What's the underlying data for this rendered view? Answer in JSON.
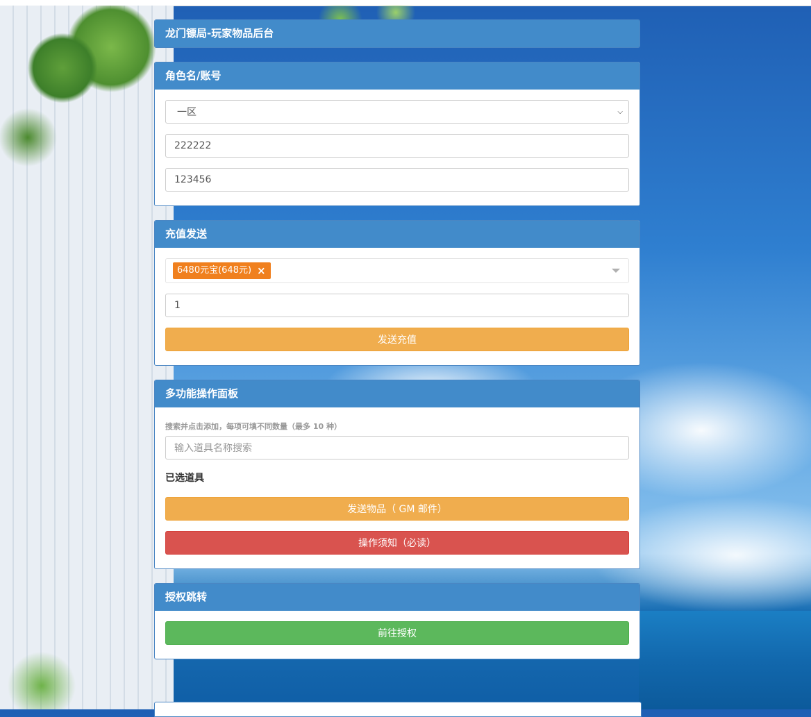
{
  "page": {
    "title": "龙门镖局-玩家物品后台"
  },
  "account": {
    "heading": "角色名/账号",
    "server_selected": "一区",
    "role_name_value": "222222",
    "password_value": "123456"
  },
  "recharge": {
    "heading": "充值发送",
    "selected_tag": "6480元宝(648元)",
    "tag_remove": "×",
    "quantity_value": "1",
    "send_label": "发送充值"
  },
  "multi": {
    "heading": "多功能操作面板",
    "hint": "搜索并点击添加，每项可填不同数量（最多 10 种）",
    "search_placeholder": "输入道具名称搜索",
    "selected_heading": "已选道具",
    "send_items_label": "发送物品（ GM 邮件）",
    "notice_label": "操作须知（必读）"
  },
  "auth": {
    "heading": "授权跳转",
    "goto_label": "前往授权"
  },
  "colors": {
    "panel_header": "#428bca",
    "warning": "#f0ad4e",
    "danger": "#d9534f",
    "success": "#5cb85c",
    "tag": "#f0801e"
  }
}
